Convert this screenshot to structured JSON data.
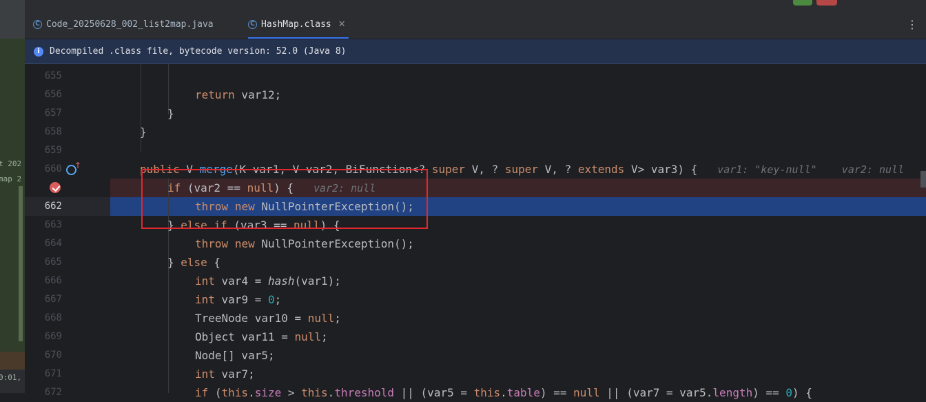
{
  "tabs": [
    {
      "label": "Code_20250628_002_list2map.java",
      "icon": "class-icon",
      "active": false
    },
    {
      "label": "HashMap.class",
      "icon": "class-icon",
      "active": true
    }
  ],
  "banner": {
    "text": "Decompiled .class file, bytecode version: 52.0 (Java 8)"
  },
  "left_panel": {
    "snippet_1": "t  202",
    "snippet_2": "map  2",
    "snippet_3": "0:01,"
  },
  "lines": {
    "l655": "655",
    "l656": "656",
    "l657": "657",
    "l658": "658",
    "l659": "659",
    "l660": "660",
    "l661": "",
    "l662": "662",
    "l663": "663",
    "l664": "664",
    "l665": "665",
    "l666": "666",
    "l667": "667",
    "l668": "668",
    "l669": "669",
    "l670": "670",
    "l671": "671",
    "l672": "672"
  },
  "code": {
    "c656_kw": "return",
    "c656_rest": " var12;",
    "c657": "}",
    "c658": "}",
    "c660_a": "public",
    "c660_b": " V ",
    "c660_c": "merge",
    "c660_d": "(",
    "c660_e": "K",
    "c660_f": " var1, ",
    "c660_g": "V",
    "c660_h": " var2, BiFunction<? ",
    "c660_i": "super",
    "c660_j": " ",
    "c660_k": "V",
    "c660_l": ", ? ",
    "c660_m": "super",
    "c660_n": " ",
    "c660_o": "V",
    "c660_p": ", ? ",
    "c660_q": "extends",
    "c660_r": " ",
    "c660_s": "V",
    "c660_t": "> var3) {",
    "c660_hint": "var1: \"key-null\"    var2: null",
    "c661_kw": "if",
    "c661_a": " (var2 == ",
    "c661_null": "null",
    "c661_b": ") {",
    "c661_hint": "var2: null",
    "c662_kw1": "throw",
    "c662_sp": " ",
    "c662_kw2": "new",
    "c662_rest": " NullPointerException();",
    "c663_a": "} ",
    "c663_else": "else",
    "c663_sp": " ",
    "c663_if": "if",
    "c663_b": " (var3 == ",
    "c663_null": "null",
    "c663_c": ") {",
    "c664_kw1": "throw",
    "c664_sp": " ",
    "c664_kw2": "new",
    "c664_rest": " NullPointerException();",
    "c665_a": "} ",
    "c665_else": "else",
    "c665_b": " {",
    "c666_kw": "int",
    "c666_a": " var4 = ",
    "c666_fn": "hash",
    "c666_b": "(var1);",
    "c667_kw": "int",
    "c667_a": " var9 = ",
    "c667_num": "0",
    "c667_b": ";",
    "c668_a": "TreeNode var10 = ",
    "c668_null": "null",
    "c668_b": ";",
    "c669_a": "Object var11 = ",
    "c669_null": "null",
    "c669_b": ";",
    "c670": "Node[] var5;",
    "c671_kw": "int",
    "c671_a": " var7;",
    "c672_if": "if",
    "c672_a": " (",
    "c672_this1": "this",
    "c672_b": ".",
    "c672_size": "size",
    "c672_c": " > ",
    "c672_this2": "this",
    "c672_d": ".",
    "c672_thr": "threshold",
    "c672_e": " || (var5 = ",
    "c672_this3": "this",
    "c672_f": ".",
    "c672_table": "table",
    "c672_g": ") == ",
    "c672_null": "null",
    "c672_h": " || (var7 = var5.",
    "c672_len": "length",
    "c672_i": ") == ",
    "c672_zero": "0",
    "c672_j": ") {"
  },
  "colors": {
    "keyword": "#cf8e6d",
    "field": "#c77dba",
    "number": "#2aacb8",
    "method": "#56a8f5",
    "selection": "#214283",
    "annotation_box": "#e0282e"
  }
}
